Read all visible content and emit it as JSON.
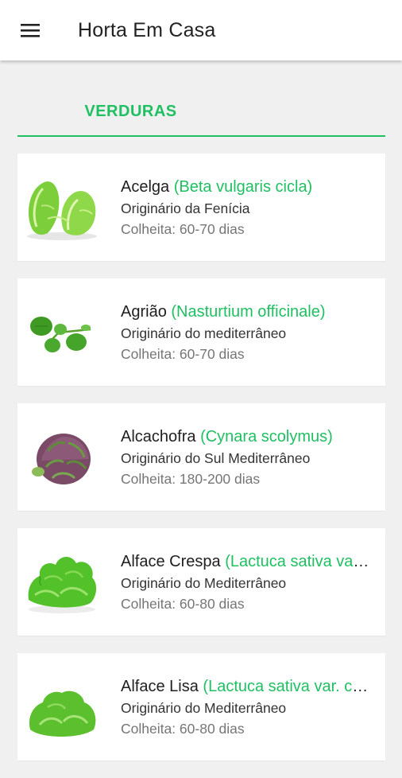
{
  "app": {
    "title": "Horta Em Casa",
    "menu_icon": "hamburger-menu-icon"
  },
  "colors": {
    "accent": "#1fbf62",
    "appbar_bg": "#ffffff",
    "page_bg": "#f0f0f0",
    "card_bg": "#ffffff",
    "primary_text": "#1f1f1f",
    "secondary_text": "#333333",
    "muted_text": "#757575"
  },
  "tabs": [
    {
      "label": "VERDURAS",
      "selected": true
    }
  ],
  "items": [
    {
      "name": "Acelga",
      "scientific": "(Beta vulgaris cicla)",
      "origin": "Originário da Fenícia",
      "harvest": "Colheita: 60-70 dias",
      "icon": "chard-icon"
    },
    {
      "name": "Agrião",
      "scientific": "(Nasturtium officinale)",
      "origin": "Originário do mediterrâneo",
      "harvest": "Colheita: 60-70 dias",
      "icon": "watercress-icon"
    },
    {
      "name": "Alcachofra",
      "scientific": "(Cynara scolymus)",
      "origin": "Originário do Sul Mediterrâneo",
      "harvest": "Colheita: 180-200 dias",
      "icon": "artichoke-icon"
    },
    {
      "name": "Alface Crespa",
      "scientific": "(Lactuca sativa var. crispa)",
      "origin": "Originário do Mediterrâneo",
      "harvest": "Colheita: 60-80 dias",
      "icon": "curly-lettuce-icon"
    },
    {
      "name": "Alface Lisa",
      "scientific": "(Lactuca sativa var. capitata)",
      "origin": "Originário do Mediterrâneo",
      "harvest": "Colheita: 60-80 dias",
      "icon": "smooth-lettuce-icon"
    }
  ]
}
